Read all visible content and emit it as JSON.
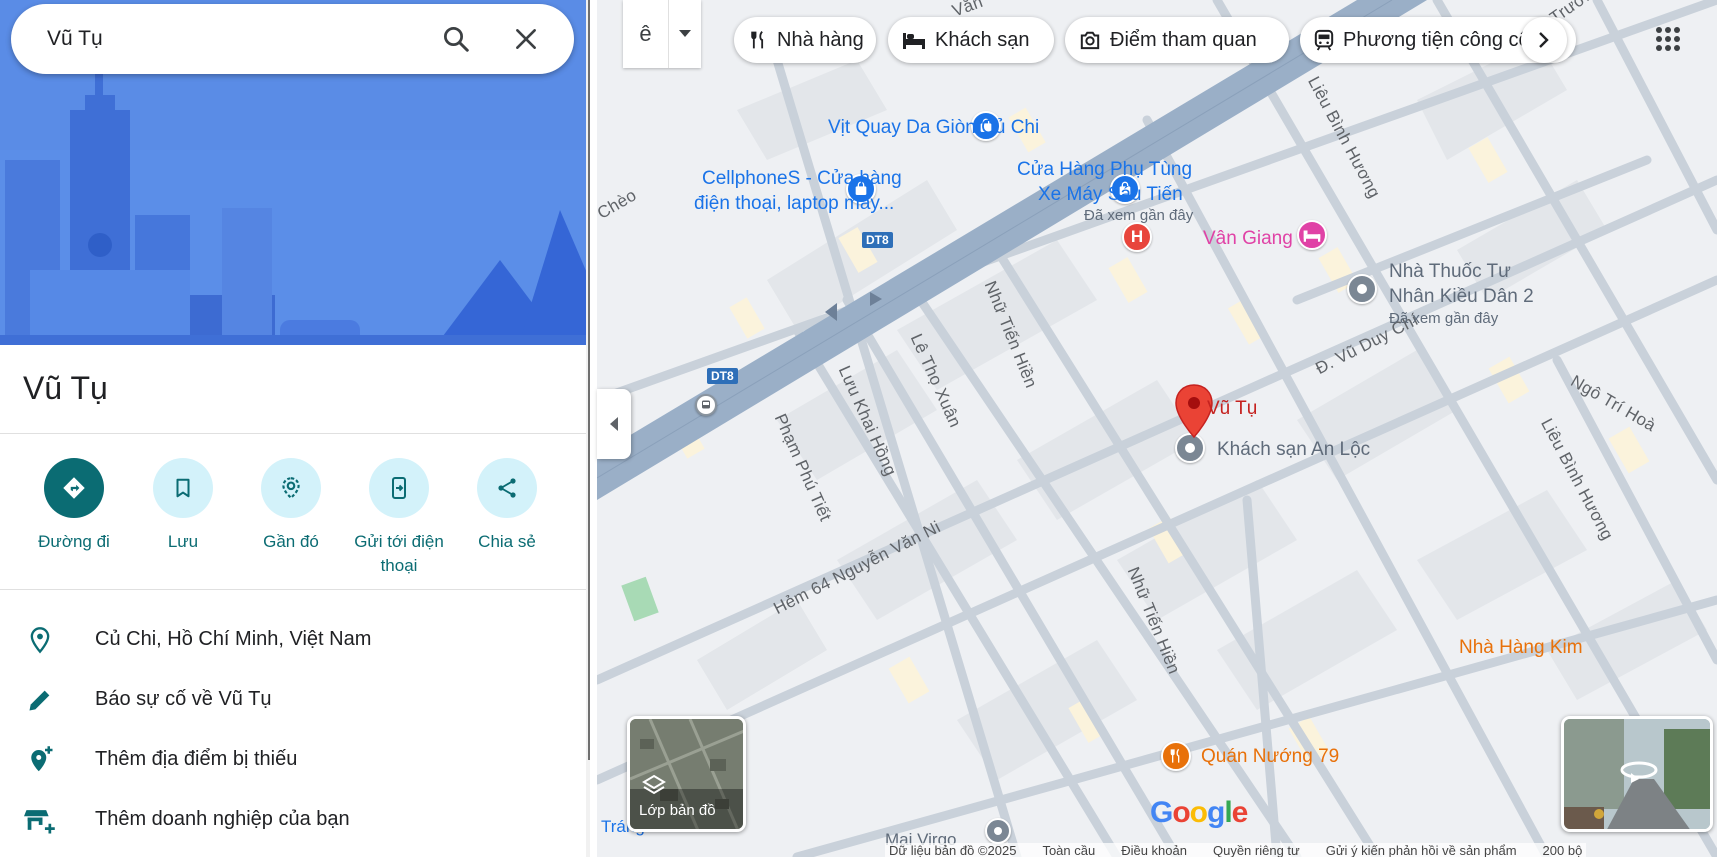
{
  "search": {
    "value": "Vũ Tụ"
  },
  "place": {
    "title": "Vũ Tụ"
  },
  "actions": [
    {
      "label": "Đường đi"
    },
    {
      "label": "Lưu"
    },
    {
      "label": "Gần đó"
    },
    {
      "label": "Gửi tới điện thoại"
    },
    {
      "label": "Chia sẻ"
    }
  ],
  "info": [
    {
      "icon": "location-pin-icon",
      "text": "Củ Chi, Hồ Chí Minh, Việt Nam"
    },
    {
      "icon": "pencil-icon",
      "text": "Báo sự cố về Vũ Tụ"
    },
    {
      "icon": "add-location-icon",
      "text": "Thêm địa điểm bị thiếu"
    },
    {
      "icon": "add-business-icon",
      "text": "Thêm doanh nghiệp của bạn"
    }
  ],
  "input_tool": {
    "glyph": "ê"
  },
  "chips": [
    {
      "icon": "restaurant-icon",
      "label": "Nhà hàng"
    },
    {
      "icon": "hotel-icon",
      "label": "Khách sạn"
    },
    {
      "icon": "camera-icon",
      "label": "Điểm tham quan"
    },
    {
      "icon": "transit-icon",
      "label": "Phương tiện công cộng"
    }
  ],
  "map": {
    "pois": {
      "vit_quay": "Vịt Quay Da Giòn Củ Chi",
      "cellphones_1": "CellphoneS - Cửa hàng",
      "cellphones_2": "điện thoại, laptop máy...",
      "phutung_1": "Cửa Hàng Phụ Tùng",
      "phutung_2": "Xe Máy Sáu Tiến",
      "phutung_sub": "Đã xem gần đây",
      "van_giang": "Vân Giang",
      "nhathuoc_1": "Nhà Thuốc Tư",
      "nhathuoc_2": "Nhân Kiều Dân 2",
      "nhathuoc_sub": "Đã xem gần đây",
      "vu_tu": "Vũ Tụ",
      "an_loc": "Khách sạn An Lộc",
      "quan_nuong": "Quán Nướng 79",
      "nha_hang_kim": "Nhà Hàng Kim",
      "mai_virgo": "Mai Virgo",
      "trang": "Tráng"
    },
    "streets": {
      "cheo": "Chèo",
      "van": "Văn",
      "truong": "Trường",
      "lieu_binh_huong_1": "Liêu Bình Hương",
      "lieu_binh_huong_2": "Liêu Bình Hương",
      "nhu_tien_hien_1": "Nhữ Tiến Hiền",
      "nhu_tien_hien_2": "Nhữ Tiến Hiền",
      "le_tho_xuan": "Lê Thọ Xuân",
      "luu_khai_hong": "Lưu Khai Hồng",
      "pham_phu_tiet": "Phạm Phú Tiết",
      "hem_64": "Hẻm 64 Nguyễn Văn Ni",
      "vu_duy_chi": "Đ. Vũ Duy Chí",
      "ngo_tri_hoa": "Ngô Trí Hoà"
    },
    "road_shields": [
      "DT8",
      "DT8"
    ],
    "layers_label": "Lớp bản đồ",
    "logo": "Google",
    "footer": [
      "Dữ liệu bản đồ ©2025",
      "Toàn cầu",
      "Điều khoản",
      "Quyền riêng tư",
      "Gửi ý kiến phản hồi về sản phẩm",
      "200 bộ"
    ]
  },
  "colors": {
    "accent": "#0b6c73",
    "marker": "#ea4335",
    "poi_blue": "#1a73e8",
    "hotel_pink": "#e042a6",
    "food_orange": "#e8710a"
  }
}
